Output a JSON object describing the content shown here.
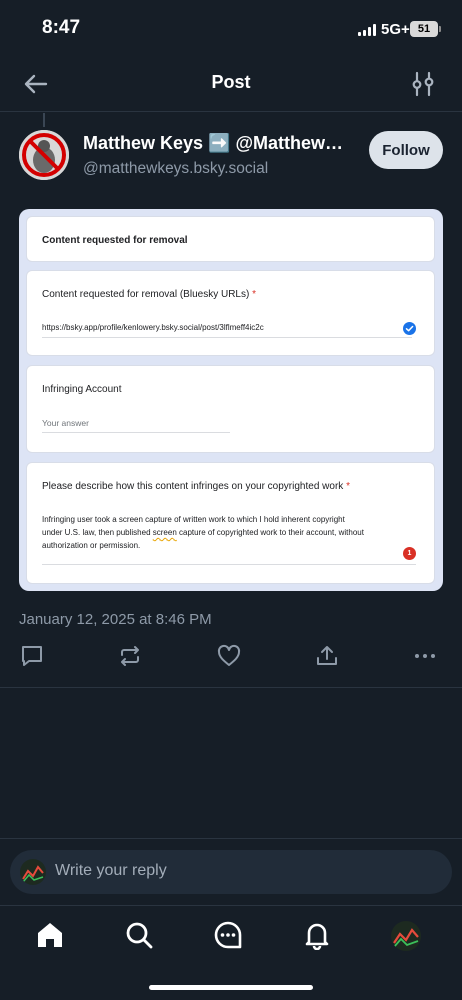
{
  "status_bar": {
    "time": "8:47",
    "network": "5G+",
    "battery": "51"
  },
  "header": {
    "title": "Post"
  },
  "post": {
    "author_name": "Matthew Keys ➡️ @Matthew…",
    "author_handle": "@matthewkeys.bsky.social",
    "follow_label": "Follow",
    "date": "January 12, 2025 at 8:46 PM"
  },
  "form": {
    "section_title": "Content requested for removal",
    "urls_label": "Content requested for removal (Bluesky URLs)",
    "urls_required": "*",
    "urls_value": "https://bsky.app/profile/kenlowery.bsky.social/post/3lflmeff4ic2c",
    "account_label": "Infringing Account",
    "account_placeholder": "Your answer",
    "describe_label": "Please describe how this content infringes on your copyrighted work",
    "describe_required": "*",
    "describe_value_1": "Infringing user took a screen capture of written work to which I hold inherent copyright",
    "describe_value_2a": "under U.S. law, then published ",
    "describe_value_2b": "screen",
    "describe_value_2c": " capture of copyrighted work to their account, without",
    "describe_value_3": "authorization or permission.",
    "error_count": "1"
  },
  "reply": {
    "placeholder": "Write your reply"
  },
  "colors": {
    "background": "#161e27",
    "follow_bg": "#dde3ea",
    "form_accent": "#1a73e8",
    "required": "#d93025"
  }
}
